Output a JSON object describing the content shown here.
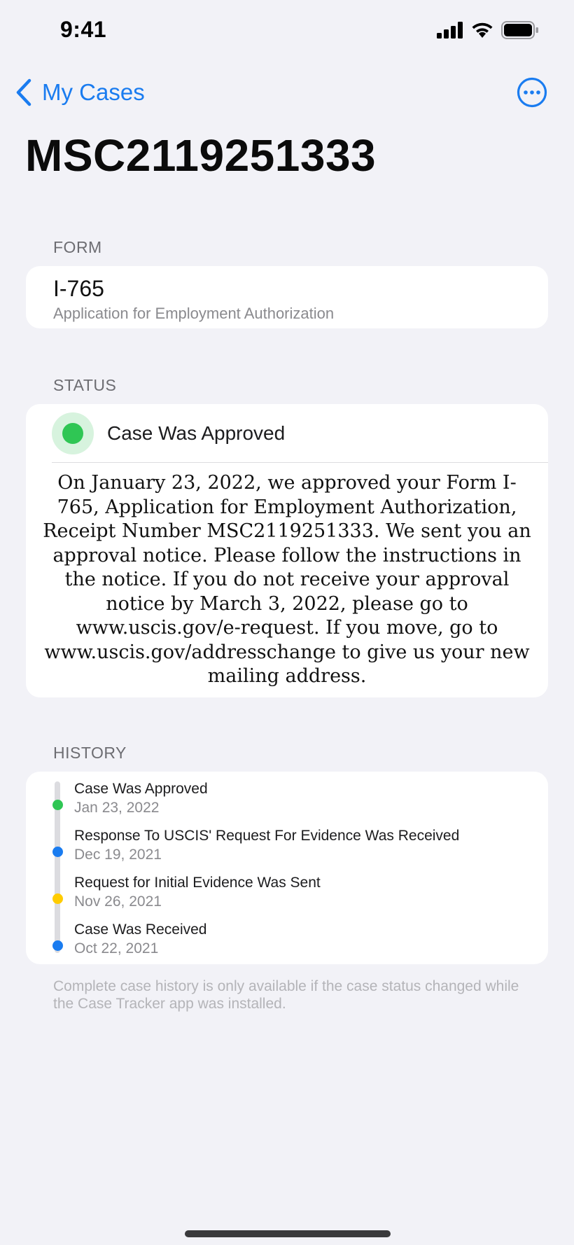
{
  "status_bar": {
    "time": "9:41"
  },
  "nav": {
    "back_label": "My Cases"
  },
  "page": {
    "title": "MSC2119251333"
  },
  "form_section": {
    "label": "FORM",
    "code": "I-765",
    "description": "Application for Employment Authorization"
  },
  "status_section": {
    "label": "STATUS",
    "title": "Case Was Approved",
    "color": "#2fc654",
    "body": "On January 23, 2022, we approved your Form I-765, Application for Employment Authorization, Receipt Number MSC2119251333. We sent you an approval notice. Please follow the instructions in the notice. If you do not receive your approval notice by March 3, 2022, please go to www.uscis.gov/e-request. If you move, go to www.uscis.gov/addresschange to give us your new mailing address."
  },
  "history_section": {
    "label": "HISTORY",
    "items": [
      {
        "title": "Case Was Approved",
        "date": "Jan 23, 2022",
        "color": "#2fc654"
      },
      {
        "title": "Response To USCIS' Request For Evidence Was Received",
        "date": "Dec 19, 2021",
        "color": "#1a7cf0"
      },
      {
        "title": "Request for Initial Evidence Was Sent",
        "date": "Nov 26, 2021",
        "color": "#ffcc00"
      },
      {
        "title": "Case Was Received",
        "date": "Oct 22, 2021",
        "color": "#1a7cf0"
      }
    ],
    "footer": "Complete case history is only available if the case status changed while the Case Tracker app was installed."
  },
  "colors": {
    "accent": "#1a7cf0",
    "background": "#f2f2f7",
    "card": "#ffffff"
  },
  "icons": {
    "back": "chevron-left-icon",
    "more": "ellipsis-circle-icon",
    "signal": "cellular-signal-icon",
    "wifi": "wifi-icon",
    "battery": "battery-icon"
  }
}
